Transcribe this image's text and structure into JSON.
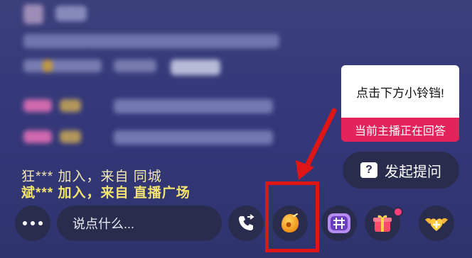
{
  "chat": {
    "join_lines": [
      {
        "who": "狂***",
        "rest": " 加入，来自 同城"
      },
      {
        "who": "斌***",
        "rest": " 加入，来自 直播广场"
      }
    ]
  },
  "tip": {
    "text": "点击下方小铃铛!",
    "badge": "当前主播正在回答"
  },
  "ask_button": {
    "icon_text": "?",
    "label": "发起提问"
  },
  "bottom_bar": {
    "input_placeholder": "说点什么..."
  },
  "colors": {
    "background": "#34387a",
    "badge": "#e2235c",
    "highlight": "#e01515",
    "arrow": "#e01515"
  }
}
